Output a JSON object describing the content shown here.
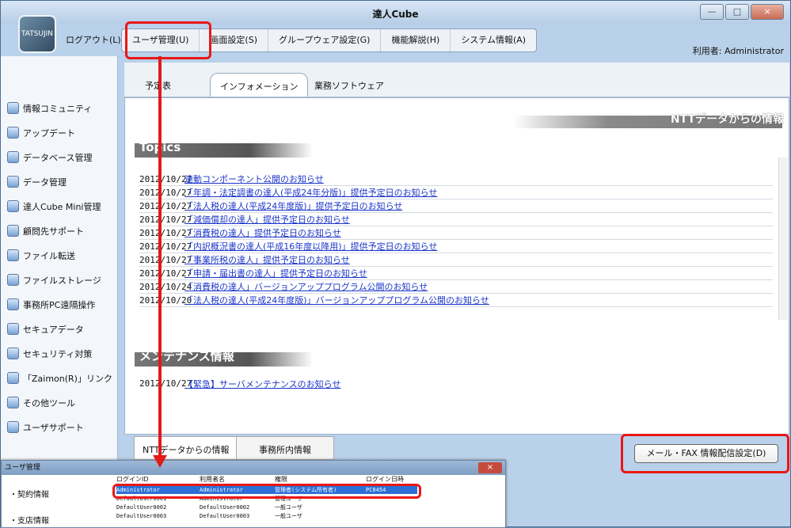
{
  "window": {
    "title": "達人Cube",
    "logo": "TATSUJIN"
  },
  "menu": {
    "logout": "ログアウト(L)",
    "items": [
      "ユーザ管理(U)",
      "画面設定(S)",
      "グループウェア設定(G)",
      "機能解説(H)",
      "システム情報(A)"
    ]
  },
  "user": "利用者: Administrator",
  "sidebar": [
    {
      "label": "情報コミュニティ",
      "icon": "info-community-icon"
    },
    {
      "label": "アップデート",
      "icon": "update-icon"
    },
    {
      "label": "データベース管理",
      "icon": "database-icon"
    },
    {
      "label": "データ管理",
      "icon": "data-management-icon"
    },
    {
      "label": "達人Cube Mini管理",
      "icon": "cube-mini-icon"
    },
    {
      "label": "顧問先サポート",
      "icon": "support-icon"
    },
    {
      "label": "ファイル転送",
      "icon": "file-transfer-icon"
    },
    {
      "label": "ファイルストレージ",
      "icon": "file-storage-icon"
    },
    {
      "label": "事務所PC遠隔操作",
      "icon": "remote-control-icon"
    },
    {
      "label": "セキュアデータ",
      "icon": "secure-data-icon"
    },
    {
      "label": "セキュリティ対策",
      "icon": "security-icon"
    },
    {
      "label": "「Zaimon(R)」リンク",
      "icon": "link-icon"
    },
    {
      "label": "その他ツール",
      "icon": "tools-icon"
    },
    {
      "label": "ユーザサポート",
      "icon": "user-support-icon"
    }
  ],
  "tabs": [
    "予定表",
    "インフォメーション",
    "業務ソフトウェア"
  ],
  "header": "NTTデータからの情報",
  "topics_title": "Topics",
  "news": [
    [
      "2012/10/27",
      "連動コンポーネント公開のお知らせ"
    ],
    [
      "2012/10/27",
      "「年調・法定調書の達人(平成24年分版)」提供予定日のお知らせ"
    ],
    [
      "2012/10/27",
      "「法人税の達人(平成24年度版)」提供予定日のお知らせ"
    ],
    [
      "2012/10/27",
      "「減価償却の達人」提供予定日のお知らせ"
    ],
    [
      "2012/10/27",
      "「消費税の達人」提供予定日のお知らせ"
    ],
    [
      "2012/10/27",
      "「内訳概況書の達人(平成16年度以降用)」提供予定日のお知らせ"
    ],
    [
      "2012/10/27",
      "「事業所税の達人」提供予定日のお知らせ"
    ],
    [
      "2012/10/27",
      "「申請・届出書の達人」提供予定日のお知らせ"
    ],
    [
      "2012/10/24",
      "「消費税の達人」バージョンアッププログラム公開のお知らせ"
    ],
    [
      "2012/10/20",
      "「法人税の達人(平成24年度版)」バージョンアッププログラム公開のお知らせ"
    ]
  ],
  "maintenance_title": "メンテナンス情報",
  "maintenance": [
    [
      "2012/10/27",
      "【緊急】サーバメンテナンスのお知らせ"
    ]
  ],
  "bottom_tabs": [
    "NTTデータからの情報",
    "事務所内情報"
  ],
  "mail_button": "メール・FAX 情報配信設定(D)",
  "popup": {
    "title": "ユーザ管理",
    "left": [
      "・契約情報",
      "・支店情報"
    ],
    "headers": [
      "ログインID",
      "利用者名",
      "権限",
      "ログイン日時"
    ],
    "rows": [
      [
        "Administrator",
        "Administrator",
        "管理者(システム所有者)",
        "PC8454"
      ],
      [
        "DefaultUser0001",
        "Administrator",
        "管理ユーザ",
        ""
      ],
      [
        "DefaultUser0002",
        "DefaultUser0002",
        "一般ユーザ",
        ""
      ],
      [
        "DefaultUser0003",
        "DefaultUser0003",
        "一般ユーザ",
        ""
      ]
    ]
  }
}
